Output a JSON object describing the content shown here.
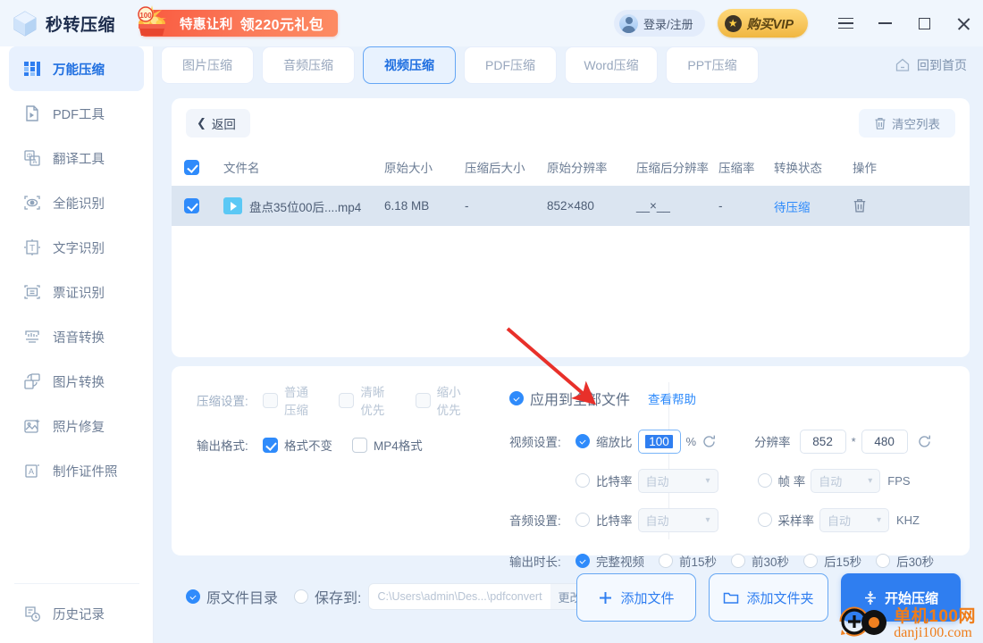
{
  "titlebar": {
    "app_name": "秒转压缩",
    "logo_icon": "cube-icon",
    "promo_text_1": "特惠让利",
    "promo_text_2": "领220元礼包",
    "promo_icon": "gift-box-icon",
    "login_label": "登录/注册",
    "login_icon": "avatar-icon",
    "vip_label": "购买VIP",
    "vip_icon": "star-icon",
    "menu_icon": "hamburger-icon",
    "minimize_icon": "minimize-icon",
    "maximize_icon": "maximize-icon",
    "close_icon": "close-icon"
  },
  "sidebar": {
    "items": [
      {
        "label": "万能压缩",
        "icon": "grid-compress-icon",
        "active": true
      },
      {
        "label": "PDF工具",
        "icon": "pdf-file-icon",
        "active": false
      },
      {
        "label": "翻译工具",
        "icon": "translate-icon",
        "active": false
      },
      {
        "label": "全能识别",
        "icon": "eye-scan-icon",
        "active": false
      },
      {
        "label": "文字识别",
        "icon": "text-ocr-icon",
        "active": false
      },
      {
        "label": "票证识别",
        "icon": "ticket-scan-icon",
        "active": false
      },
      {
        "label": "语音转换",
        "icon": "audio-wave-icon",
        "active": false
      },
      {
        "label": "图片转换",
        "icon": "image-convert-icon",
        "active": false
      },
      {
        "label": "照片修复",
        "icon": "photo-repair-icon",
        "active": false
      },
      {
        "label": "制作证件照",
        "icon": "id-photo-icon",
        "active": false
      }
    ],
    "history": {
      "label": "历史记录",
      "icon": "history-clock-icon"
    }
  },
  "tabs": [
    {
      "label": "图片压缩",
      "active": false
    },
    {
      "label": "音频压缩",
      "active": false
    },
    {
      "label": "视频压缩",
      "active": true
    },
    {
      "label": "PDF压缩",
      "active": false
    },
    {
      "label": "Word压缩",
      "active": false
    },
    {
      "label": "PPT压缩",
      "active": false
    }
  ],
  "home_link": {
    "label": "回到首页",
    "icon": "home-icon"
  },
  "list": {
    "back_label": "返回",
    "back_icon": "chevron-left-icon",
    "clear_label": "清空列表",
    "clear_icon": "trash-icon",
    "header_checked": true,
    "columns": [
      "文件名",
      "原始大小",
      "压缩后大小",
      "原始分辨率",
      "压缩后分辨率",
      "压缩率",
      "转换状态",
      "操作"
    ],
    "rows": [
      {
        "checked": true,
        "file_icon": "video-play-icon",
        "filename": "盘点35位00后....mp4",
        "original_size": "6.18 MB",
        "compressed_size": "-",
        "original_resolution": "852×480",
        "compressed_resolution": "__×__",
        "compress_rate": "-",
        "status": "待压缩",
        "delete_icon": "trash-icon"
      }
    ]
  },
  "settings": {
    "compress_label": "压缩设置:",
    "compress_options": [
      {
        "label": "普通压缩",
        "checked": false,
        "disabled": true
      },
      {
        "label": "清晰优先",
        "checked": false,
        "disabled": true
      },
      {
        "label": "缩小优先",
        "checked": false,
        "disabled": true
      }
    ],
    "format_label": "输出格式:",
    "format_options": [
      {
        "label": "格式不变",
        "checked": true,
        "disabled": false
      },
      {
        "label": "MP4格式",
        "checked": false,
        "disabled": false
      }
    ],
    "apply_all_label": "应用到全部文件",
    "apply_all_checked": true,
    "help_label": "查看帮助",
    "video_label": "视频设置:",
    "scale_label": "缩放比",
    "scale_checked": true,
    "scale_value": "100",
    "percent_unit": "%",
    "resolution_label": "分辨率",
    "resolution_width": "852",
    "resolution_sep": "*",
    "resolution_height": "480",
    "refresh_icon": "refresh-icon",
    "video_bitrate_label": "比特率",
    "video_bitrate_value": "自动",
    "video_bitrate_checked": false,
    "framerate_label": "帧 率",
    "framerate_value": "自动",
    "framerate_checked": false,
    "framerate_unit": "FPS",
    "audio_label": "音频设置:",
    "audio_bitrate_label": "比特率",
    "audio_bitrate_value": "自动",
    "audio_bitrate_checked": false,
    "samplerate_label": "采样率",
    "samplerate_value": "自动",
    "samplerate_checked": false,
    "samplerate_unit": "KHZ",
    "duration_label": "输出时长:",
    "duration_options": [
      {
        "label": "完整视频",
        "checked": true
      },
      {
        "label": "前15秒",
        "checked": false
      },
      {
        "label": "前30秒",
        "checked": false
      },
      {
        "label": "后15秒",
        "checked": false
      },
      {
        "label": "后30秒",
        "checked": false
      }
    ]
  },
  "bottom": {
    "source_dir_label": "原文件目录",
    "source_dir_checked": true,
    "save_to_label": "保存到:",
    "save_to_checked": false,
    "save_path": "C:\\Users\\admin\\Des...\\pdfconvert",
    "change_label": "更改",
    "add_file_label": "添加文件",
    "add_file_icon": "plus-icon",
    "add_folder_label": "添加文件夹",
    "add_folder_icon": "folder-icon",
    "start_label": "开始压缩",
    "start_icon": "compress-arrows-icon"
  },
  "watermark": {
    "text_cn": "单机100网",
    "text_en": "danji100.com",
    "icon": "danji-logo-icon"
  },
  "colors": {
    "accent": "#2f7ef0",
    "accent_light": "#2f8bfb",
    "page_bg": "#eaf2fc",
    "promo_red": "#f9593f",
    "vip_gold": "#f8c860",
    "arrow_red": "#e8302a",
    "watermark_orange": "#ef7d1a"
  }
}
